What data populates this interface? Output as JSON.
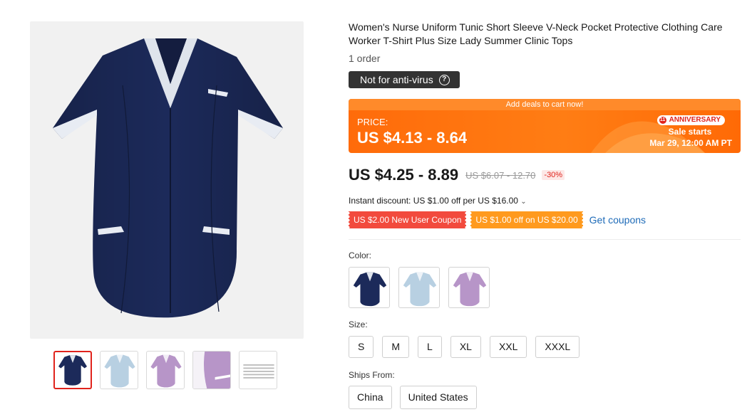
{
  "product": {
    "title": "Women's Nurse Uniform Tunic Short Sleeve V-Neck Pocket Protective Clothing Care Worker T-Shirt Plus Size Lady Summer Clinic Tops",
    "orders": "1 order",
    "badge_label": "Not for anti-virus",
    "badge_icon": "question-circle-icon"
  },
  "gallery": {
    "main_color": "#1c2a5a",
    "thumbnails": [
      {
        "name": "navy",
        "color": "#1c2a5a",
        "selected": true
      },
      {
        "name": "light-blue",
        "color": "#b8d0e2",
        "selected": false
      },
      {
        "name": "lavender",
        "color": "#b795c8",
        "selected": false
      },
      {
        "name": "lavender-detail",
        "color": "#b795c8",
        "selected": false
      },
      {
        "name": "size-chart",
        "color": "#cccccc",
        "selected": false
      }
    ]
  },
  "promo": {
    "banner_text": "Add deals to cart now!",
    "price_label": "PRICE:",
    "price_range": "US $4.13 - 8.64",
    "anniversary_badge": "ANNIVERSARY",
    "anniversary_icon": "11-logo-icon",
    "sale_starts": "Sale starts",
    "sale_date": "Mar 29, 12:00 AM PT",
    "accent_color": "#ff6b0a"
  },
  "pricing": {
    "current": "US $4.25 - 8.89",
    "original": "US $6.07 - 12.70",
    "discount": "-30%"
  },
  "instant_discount": "Instant discount: US $1.00 off per US $16.00",
  "coupons": [
    {
      "label": "US $2.00 New User Coupon",
      "color": "#f24a3d"
    },
    {
      "label": "US $1.00 off on US $20.00",
      "color": "#ff9a1e"
    }
  ],
  "get_coupons_label": "Get coupons",
  "color": {
    "label": "Color:",
    "options": [
      {
        "name": "navy",
        "fill": "#1c2a5a"
      },
      {
        "name": "light-blue",
        "fill": "#b8d0e2"
      },
      {
        "name": "lavender",
        "fill": "#b795c8"
      }
    ]
  },
  "size": {
    "label": "Size:",
    "options": [
      "S",
      "M",
      "L",
      "XL",
      "XXL",
      "XXXL"
    ]
  },
  "ships_from": {
    "label": "Ships From:",
    "options": [
      "China",
      "United States"
    ]
  }
}
